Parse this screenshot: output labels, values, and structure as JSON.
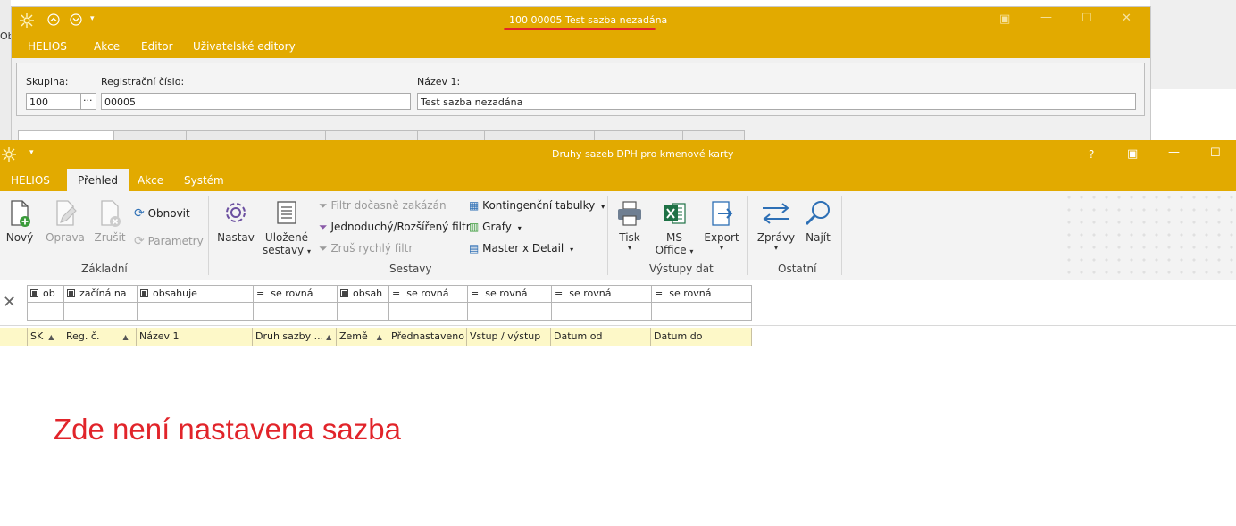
{
  "background_window": {
    "title": "100 00005 Test sazba nezadána",
    "left_clip_text": "Ob",
    "menu": [
      "HELIOS",
      "Akce",
      "Editor",
      "Uživatelské editory"
    ],
    "form": {
      "skupina_label": "Skupina:",
      "skupina_value": "100",
      "lookup_button": "···",
      "reg_label": "Registrační číslo:",
      "reg_value": "00005",
      "nazev_label": "Název 1:",
      "nazev_value": "Test sazba nezadána"
    }
  },
  "window": {
    "title": "Druhy sazeb DPH pro kmenové karty",
    "help": "?",
    "tabs": [
      "HELIOS",
      "Přehled",
      "Akce",
      "Systém"
    ],
    "active_tab": "Přehled"
  },
  "ribbon": {
    "zakladni": {
      "label": "Základní",
      "novy": "Nový",
      "oprava": "Oprava",
      "zrusit": "Zrušit",
      "obnovit": "Obnovit",
      "parametry": "Parametry"
    },
    "sestavy": {
      "label": "Sestavy",
      "nastav": "Nastav",
      "ulozene_line1": "Uložené",
      "ulozene_line2": "sestavy",
      "filtr_docasne": "Filtr dočasně zakázán",
      "jednoduchy_filtr": "Jednoduchý/Rozšířený filtr",
      "zrus_rychly": "Zruš rychlý filtr",
      "kontingencni": "Kontingenční tabulky",
      "grafy": "Grafy",
      "master_detail": "Master x Detail"
    },
    "vystupy": {
      "label": "Výstupy dat",
      "tisk": "Tisk",
      "ms_line1": "MS",
      "ms_line2": "Office",
      "export": "Export"
    },
    "ostatni": {
      "label": "Ostatní",
      "zpravy": "Zprávy",
      "najit": "Najít"
    }
  },
  "filter_row": [
    "ob",
    "začíná na",
    "obsahuje",
    "se rovná",
    "obsah",
    "se rovná",
    "se rovná",
    "se rovná",
    "se rovná"
  ],
  "columns": [
    "SK",
    "Reg. č.",
    "Název 1",
    "Druh sazby ...",
    "Země",
    "Přednastaveno",
    "Vstup / výstup",
    "Datum od",
    "Datum do"
  ],
  "annotation": "Zde není nastavena sazba",
  "colors": {
    "accent": "#e2aa00",
    "annotation": "#e1242a",
    "header_bg": "#fdf8c8"
  }
}
